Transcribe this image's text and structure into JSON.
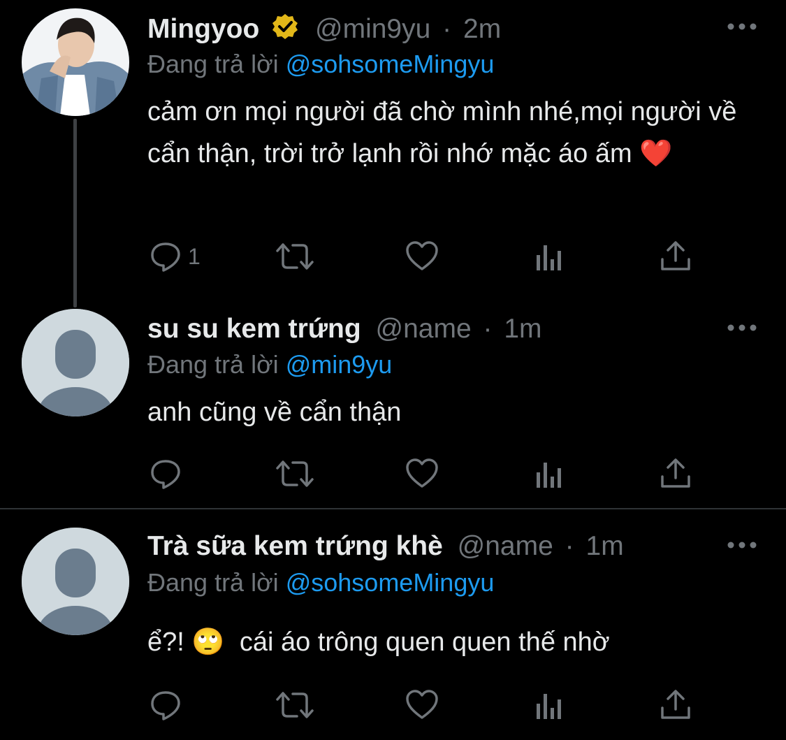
{
  "tweets": [
    {
      "name": "Mingyoo",
      "handle": "@min9yu",
      "time": "2m",
      "replying_prefix": "Đang trả lời",
      "replying_to": "@sohsomeMingyu",
      "text": "cảm ơn mọi người đã chờ mình nhé,mọi người về cẩn thận, trời trở lạnh rồi nhớ mặc áo ấm ❤️",
      "reply_count": "1",
      "avatar": "profile-photo",
      "verified": true
    },
    {
      "name": "su su kem trứng",
      "handle": "@name",
      "time": "1m",
      "replying_prefix": "Đang trả lời",
      "replying_to": "@min9yu",
      "text": "anh cũng về cẩn thận",
      "reply_count": "",
      "avatar": "default-avatar"
    },
    {
      "name": "Trà sữa kem trứng khè",
      "handle": "@name",
      "time": "1m",
      "replying_prefix": "Đang trả lời",
      "replying_to": "@sohsomeMingyu",
      "text": "ể?! 🙄  cái áo trông quen quen thế nhờ",
      "reply_count": "",
      "avatar": "default-avatar"
    }
  ],
  "separator": "·",
  "colors": {
    "background": "#000000",
    "text": "#e7e9ea",
    "muted": "#71767b",
    "link": "#1d9bf0",
    "verified_badge": "#e2b719"
  },
  "icons": [
    "reply-icon",
    "retweet-icon",
    "like-icon",
    "analytics-icon",
    "share-icon",
    "more-icon",
    "verified-badge-icon"
  ]
}
